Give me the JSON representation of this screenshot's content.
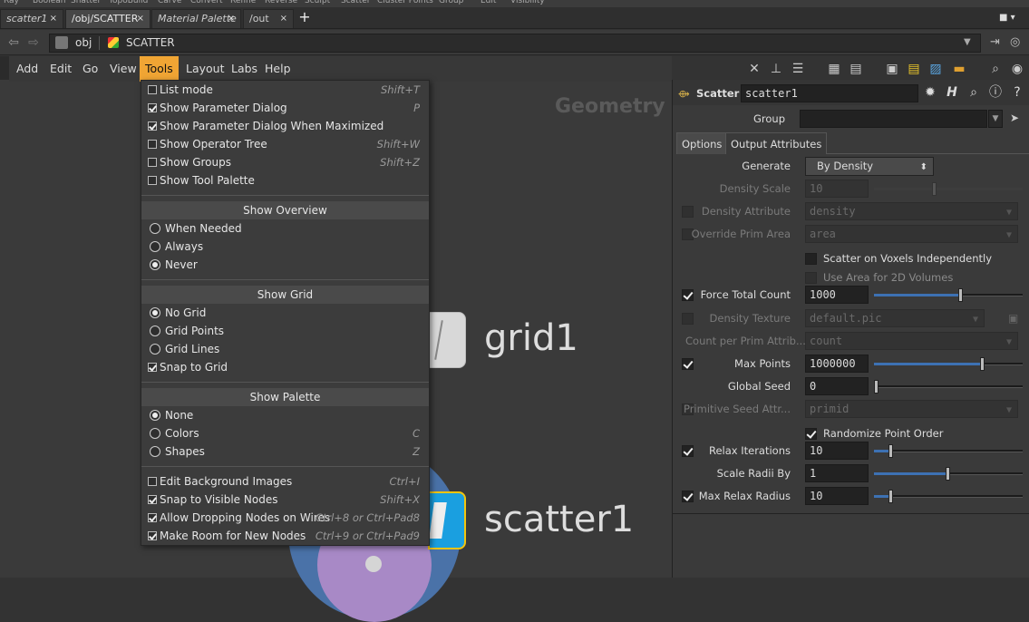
{
  "shelf": [
    "Ray",
    "Boolean",
    "Shatter",
    "TopoBuild",
    "Carve",
    "Convert",
    "Refine",
    "Reverse",
    "Sculpt",
    "Scatter",
    "Cluster Points",
    "Group",
    "Edit",
    "Visibility"
  ],
  "tabs": [
    {
      "label": "scatter1",
      "close": "×"
    },
    {
      "label": "/obj/SCATTER",
      "close": "×"
    },
    {
      "label": "Material Palette",
      "close": "×"
    },
    {
      "label": "/out",
      "close": "×"
    }
  ],
  "add_tab": "+",
  "path": {
    "obj": "obj",
    "current": "SCATTER"
  },
  "menubar": [
    "Add",
    "Edit",
    "Go",
    "View",
    "Tools",
    "Layout",
    "Labs",
    "Help"
  ],
  "network": {
    "context_label": "Geometry",
    "grid_node": "grid1",
    "scatter_node": "scatter1"
  },
  "colors": {
    "menu_highlight": "#f0a534",
    "node_selected": "#1a9fe0",
    "node_outline": "#f2c40e",
    "slider": "#3d71b3"
  },
  "tools_menu": {
    "items1": [
      {
        "label": "List mode",
        "shortcut": "Shift+T",
        "checked": false
      },
      {
        "label": "Show Parameter Dialog",
        "shortcut": "P",
        "checked": true
      },
      {
        "label": "Show Parameter Dialog When Maximized",
        "shortcut": "",
        "checked": true
      },
      {
        "label": "Show Operator Tree",
        "shortcut": "Shift+W",
        "checked": false
      },
      {
        "label": "Show Groups",
        "shortcut": "Shift+Z",
        "checked": false
      },
      {
        "label": "Show Tool Palette",
        "shortcut": "",
        "checked": false
      }
    ],
    "overview_header": "Show Overview",
    "overview": [
      {
        "label": "When Needed",
        "selected": false
      },
      {
        "label": "Always",
        "selected": false
      },
      {
        "label": "Never",
        "selected": true
      }
    ],
    "grid_header": "Show Grid",
    "grid": [
      {
        "label": "No Grid",
        "selected": true
      },
      {
        "label": "Grid Points",
        "selected": false
      },
      {
        "label": "Grid Lines",
        "selected": false
      }
    ],
    "snap_to_grid": {
      "label": "Snap to Grid",
      "checked": true
    },
    "palette_header": "Show Palette",
    "palette": [
      {
        "label": "None",
        "shortcut": "",
        "selected": true
      },
      {
        "label": "Colors",
        "shortcut": "C",
        "selected": false
      },
      {
        "label": "Shapes",
        "shortcut": "Z",
        "selected": false
      }
    ],
    "items2": [
      {
        "label": "Edit Background Images",
        "shortcut": "Ctrl+I",
        "checked": false
      },
      {
        "label": "Snap to Visible Nodes",
        "shortcut": "Shift+X",
        "checked": true
      },
      {
        "label": "Allow Dropping Nodes on Wires",
        "shortcut": "Ctrl+8 or Ctrl+Pad8",
        "checked": true
      },
      {
        "label": "Make Room for New Nodes",
        "shortcut": "Ctrl+9 or Ctrl+Pad9",
        "checked": true
      }
    ]
  },
  "params": {
    "node_type": "Scatter",
    "node_name": "scatter1",
    "group_label": "Group",
    "group_value": "",
    "tabs": [
      "Options",
      "Output Attributes"
    ],
    "generate": {
      "label": "Generate",
      "value": "By Density"
    },
    "density_scale": {
      "label": "Density Scale",
      "value": "10"
    },
    "density_attribute": {
      "label": "Density Attribute",
      "value": "density"
    },
    "override_prim_area": {
      "label": "Override Prim Area",
      "value": "area"
    },
    "scatter_voxels": {
      "label": "Scatter on Voxels Independently"
    },
    "use_area_2d": {
      "label": "Use Area for 2D Volumes"
    },
    "force_total_count": {
      "label": "Force Total Count",
      "value": "1000",
      "fraction": 0.59
    },
    "density_texture": {
      "label": "Density Texture",
      "value": "default.pic"
    },
    "count_per_prim": {
      "label": "Count per Prim Attrib...",
      "value": "count"
    },
    "max_points": {
      "label": "Max Points",
      "value": "1000000",
      "fraction": 0.74
    },
    "global_seed": {
      "label": "Global Seed",
      "value": "0",
      "fraction": 0.0
    },
    "prim_seed_attr": {
      "label": "Primitive Seed Attr...",
      "value": "primid"
    },
    "randomize": {
      "label": "Randomize Point Order"
    },
    "relax_iterations": {
      "label": "Relax Iterations",
      "value": "10",
      "fraction": 0.1
    },
    "scale_radii": {
      "label": "Scale Radii By",
      "value": "1",
      "fraction": 0.5
    },
    "max_relax_radius": {
      "label": "Max Relax Radius",
      "value": "10",
      "fraction": 0.1
    }
  }
}
